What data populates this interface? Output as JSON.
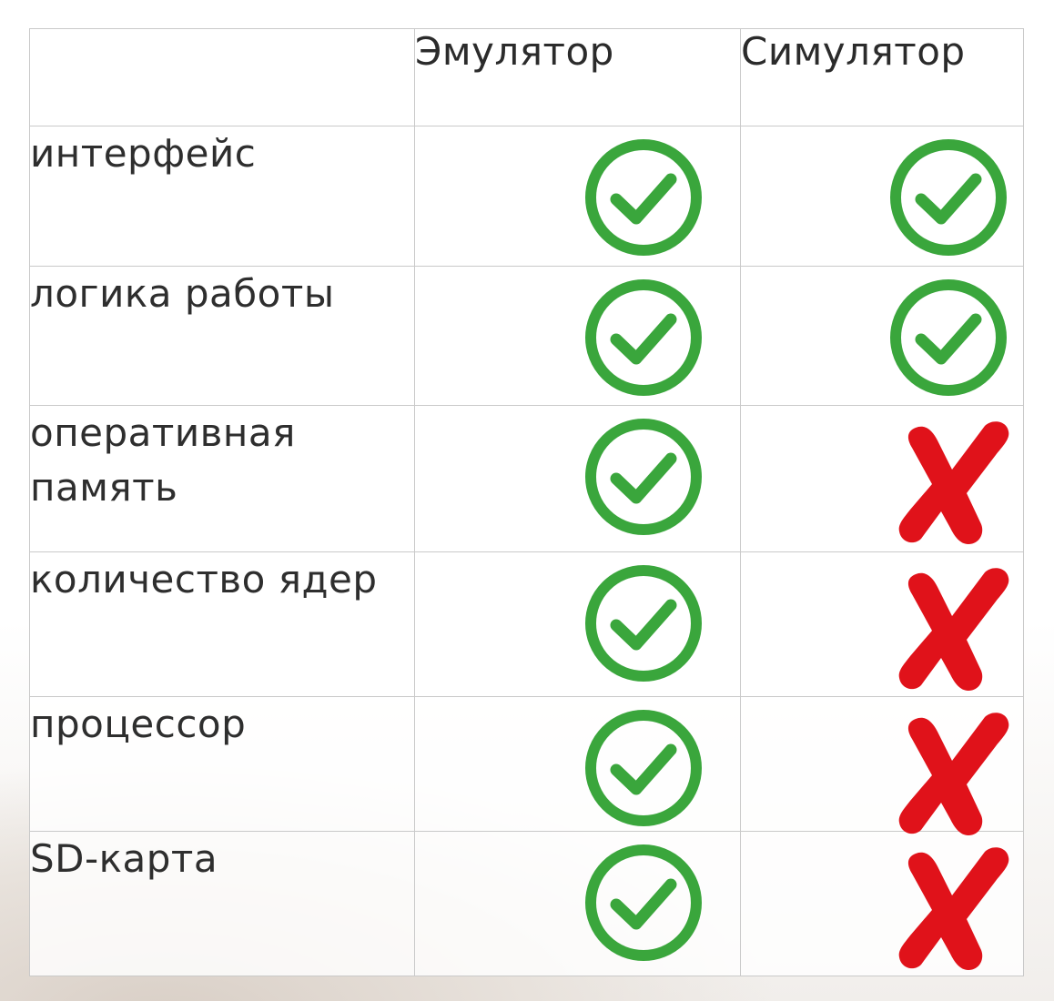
{
  "table": {
    "columns": [
      "",
      "Эмулятор",
      "Симулятор"
    ],
    "rows": [
      {
        "label": "интерфейс",
        "emulator": "check",
        "simulator": "check"
      },
      {
        "label": "логика работы",
        "emulator": "check",
        "simulator": "check"
      },
      {
        "label": "оперативная память",
        "emulator": "check",
        "simulator": "cross"
      },
      {
        "label": "количество ядер",
        "emulator": "check",
        "simulator": "cross"
      },
      {
        "label": "процессор",
        "emulator": "check",
        "simulator": "cross"
      },
      {
        "label": "SD-карта",
        "emulator": "check",
        "simulator": "cross"
      }
    ]
  },
  "icons": {
    "check": "check-circle-icon",
    "cross": "cross-icon"
  },
  "colors": {
    "check_green": "#3aa63c",
    "cross_red": "#e0121a",
    "grid": "#c9c9c9",
    "text": "#2e2e2e"
  }
}
